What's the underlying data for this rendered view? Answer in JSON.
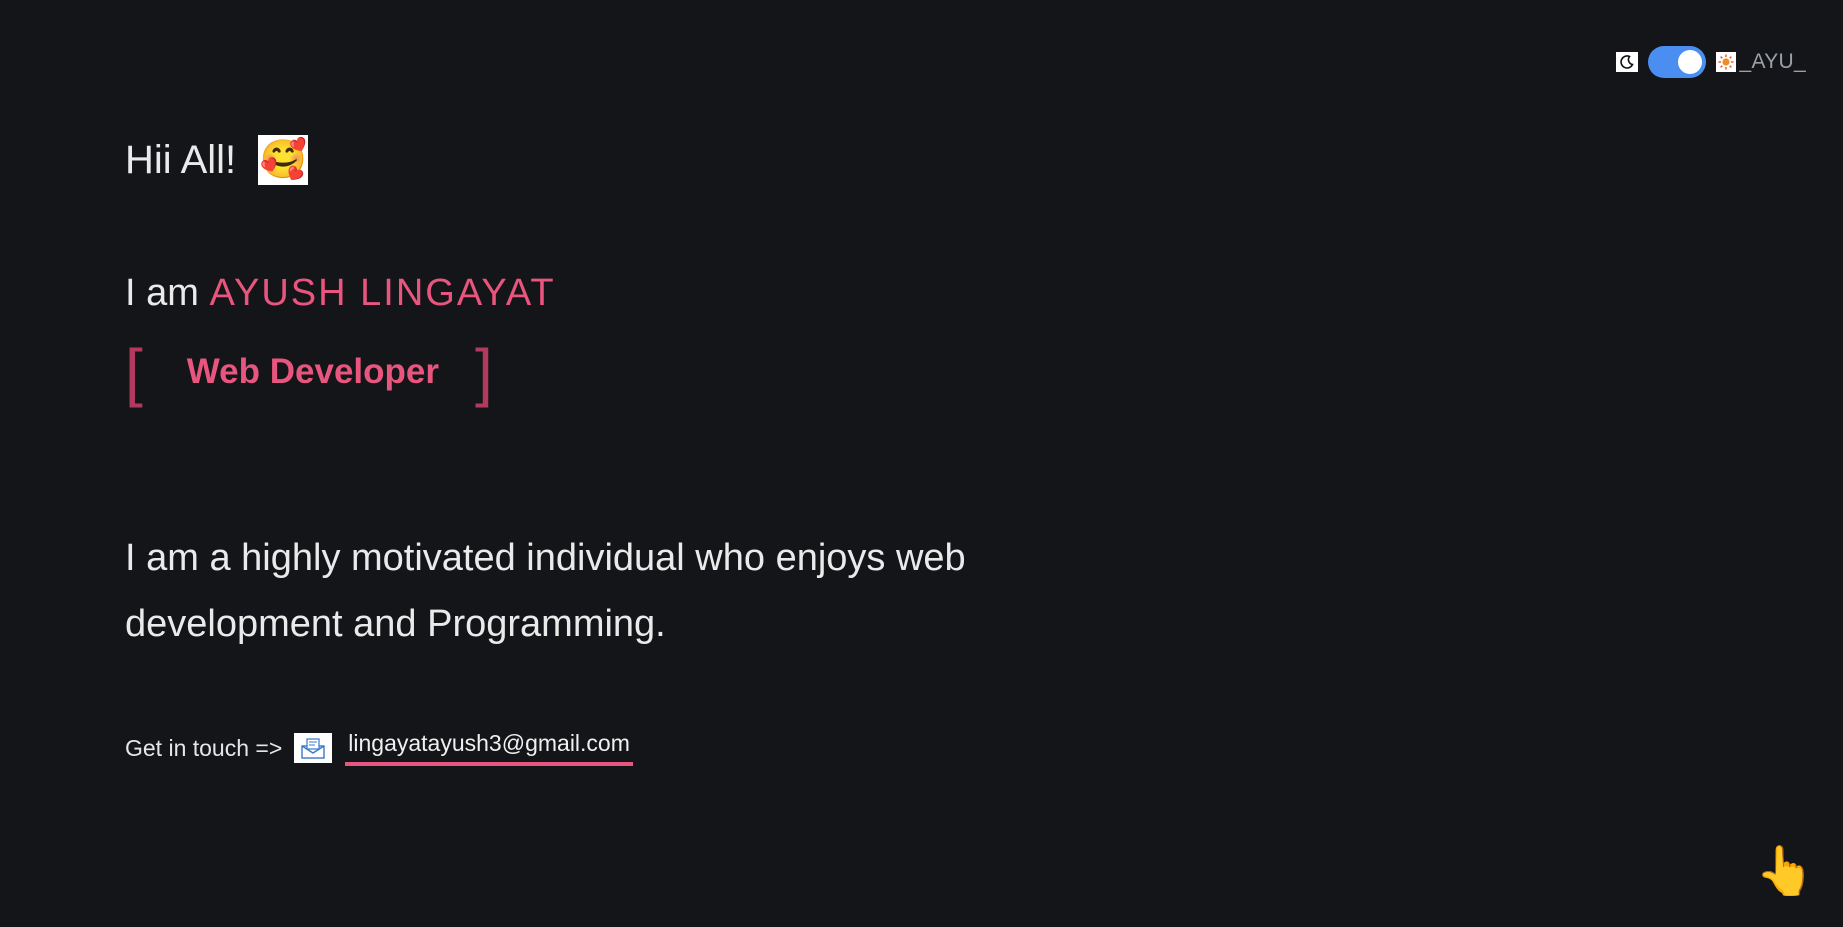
{
  "header": {
    "brand": "_AYU_",
    "moon_icon": "moon-icon",
    "sun_icon": "sun-icon",
    "theme_toggle_on": true
  },
  "hero": {
    "greeting": "Hii All!",
    "greeting_emoji": "🥰",
    "intro_prefix": "I am ",
    "name": "AYUSH LINGAYAT",
    "bracket_open": "[",
    "role": "Web Developer",
    "bracket_close": "]"
  },
  "bio": {
    "text": "I am a highly motivated individual who enjoys web development and Programming."
  },
  "contact": {
    "label": "Get in touch =>",
    "mail_icon": "mail-icon",
    "email": "lingayatayush3@gmail.com"
  },
  "floating": {
    "pointer_emoji": "👆"
  },
  "colors": {
    "background": "#141518",
    "accent": "#e8557e",
    "bracket": "#b23a5e",
    "toggle": "#4b8ef1"
  }
}
